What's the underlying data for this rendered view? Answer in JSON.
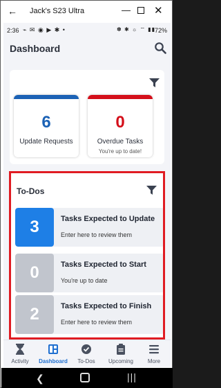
{
  "window": {
    "title": "Jack's S23 Ultra",
    "back_glyph": "←",
    "min_glyph": "—",
    "close_glyph": "✕"
  },
  "statusbar": {
    "time": "2:36",
    "left_icons": "⌁ ✉ ◉ ▶ ✱ •",
    "right_icons": "✽ ✱ ☼ ⌔ ▮▮",
    "battery": "72%"
  },
  "header": {
    "title": "Dashboard"
  },
  "summary": {
    "cards": [
      {
        "value": "6",
        "label": "Update Requests",
        "sub": "",
        "accent": "#1c62b5",
        "value_color": "#1c62b5"
      },
      {
        "value": "0",
        "label": "Overdue Tasks",
        "sub": "You're up to date!",
        "accent": "#d40f1a",
        "value_color": "#d40f1a"
      }
    ]
  },
  "todos": {
    "title": "To-Dos",
    "items": [
      {
        "count": "3",
        "title": "Tasks Expected to Update",
        "subtitle": "Enter here to review them",
        "badge_color": "#1e7fe6"
      },
      {
        "count": "0",
        "title": "Tasks Expected to Start",
        "subtitle": "You're up to date",
        "badge_color": "#c1c5cd"
      },
      {
        "count": "2",
        "title": "Tasks Expected to Finish",
        "subtitle": "Enter here to review them",
        "badge_color": "#c1c5cd"
      }
    ]
  },
  "nav": {
    "items": [
      {
        "label": "Activity",
        "icon": "hourglass-icon"
      },
      {
        "label": "Dashboard",
        "icon": "dashboard-icon",
        "active": true
      },
      {
        "label": "To-Dos",
        "icon": "check-circle-icon"
      },
      {
        "label": "Upcoming",
        "icon": "clipboard-icon"
      },
      {
        "label": "More",
        "icon": "menu-icon"
      }
    ]
  },
  "colors": {
    "accent": "#1e6fd0",
    "highlight": "#e01b22"
  }
}
